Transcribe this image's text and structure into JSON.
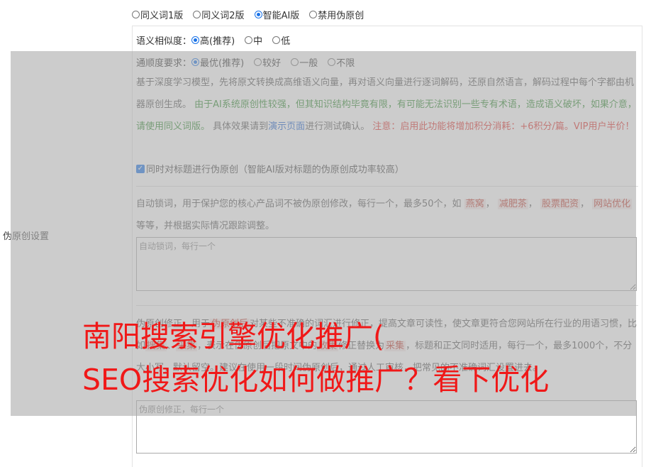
{
  "mode_options": [
    {
      "label": "同义词1版",
      "selected": false
    },
    {
      "label": "同义词2版",
      "selected": false
    },
    {
      "label": "智能AI版",
      "selected": true
    },
    {
      "label": "禁用伪原创",
      "selected": false
    }
  ],
  "similarity": {
    "label": "语义相似度：",
    "options": [
      {
        "label": "高(推荐)",
        "selected": true
      },
      {
        "label": "中",
        "selected": false
      },
      {
        "label": "低",
        "selected": false
      }
    ]
  },
  "fluency": {
    "label": "通顺度要求：",
    "options": [
      {
        "label": "最优(推荐)",
        "selected": true
      },
      {
        "label": "较好",
        "selected": false
      },
      {
        "label": "一般",
        "selected": false
      },
      {
        "label": "不限",
        "selected": false
      }
    ]
  },
  "description": {
    "part1": "基于深度学习模型，先将原文转换成高维语义向量，再对语义向量进行逐词解码，还原自然语言，解码过程中每个字都由机器原创生成。",
    "part2_green": "由于AI系统原创性较强，但其知识结构毕竟有限，有可能无法识别一些专有术语，造成语义破坏，如果介意，请使用同义词版。",
    "part3": "具体效果请到",
    "link": "演示页面",
    "part4": "进行测试确认。",
    "part5_red": "注意：启用此功能将增加积分消耗：+6积分/篇。VIP用户半价！"
  },
  "title_checkbox": {
    "label": "同时对标题进行伪原创（智能AI版对标题的伪原创成功率较高）",
    "checked": true
  },
  "side_label": "伪原创设置",
  "lock_words": {
    "text1": "自动锁词，用于保护您的核心产品词不被伪原创修改，每行一个，最多50个，如",
    "tags": [
      "燕窝",
      "减肥茶",
      "股票配资",
      "网站优化"
    ],
    "text2": "等等，并根据实际情况跟踪调整。",
    "placeholder": "自动锁词，每行一个"
  },
  "correction": {
    "text1": "伪原创修正，用于",
    "tag1": "伪原创后",
    "text2": "对某些不准确的词汇进行修正，提高文章可读性，使文章更符合您网站所在行业的用语习惯，比如",
    "tag2": "搜集",
    "text3": "、",
    "tag3": "采集",
    "text4": "，表示在伪原创后把原文中的",
    "tag4": "收集",
    "text5": "修正替换为",
    "tag5": "采集",
    "text6": "，标题和正文同时适用，每行一个，最多1000个，不分大小写，默认留空。建议在使用一段时间伪原创后，通过人工审核，把常见的不准确词汇设置进去。",
    "placeholder": "伪原创修正，每行一个"
  },
  "overlay_title": {
    "line1": "南阳搜索引擎优化推广(",
    "line2": "SEO搜索优化如何做推广？看下优化"
  }
}
